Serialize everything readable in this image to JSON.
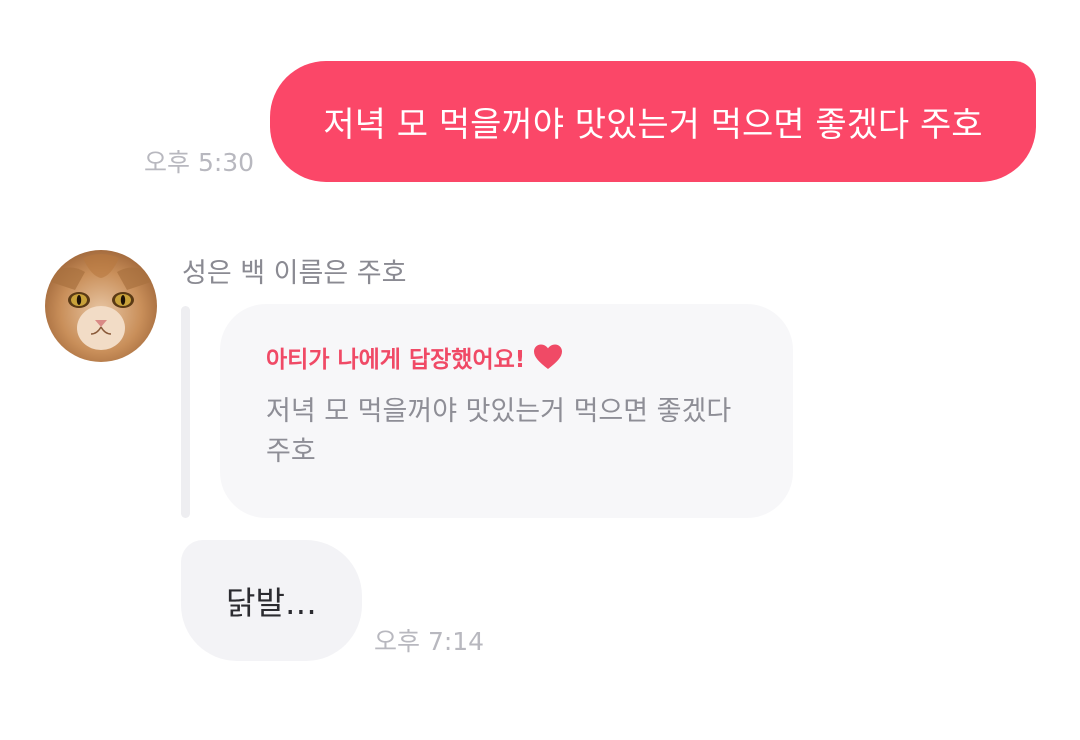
{
  "colors": {
    "outgoing_bubble": "#fb4768",
    "incoming_bubble": "#f3f3f6",
    "reply_card": "#f7f7f9",
    "reply_accent": "#f04a66",
    "timestamp": "#b8b8bf"
  },
  "outgoing_message": {
    "text": "저녁 모 먹을꺼야 맛있는거 먹으면 좋겠다 주호",
    "time": "오후 5:30"
  },
  "incoming_message": {
    "sender_name": "성은 백 이름은 주호",
    "avatar_icon": "cat-avatar",
    "reply": {
      "header": "아티가 나에게 답장했어요!",
      "header_icon": "heart-icon",
      "quoted_text": "저녁 모 먹을꺼야 맛있는거 먹으면 좋겠다 주호"
    },
    "text": "닭발…",
    "time": "오후 7:14"
  }
}
